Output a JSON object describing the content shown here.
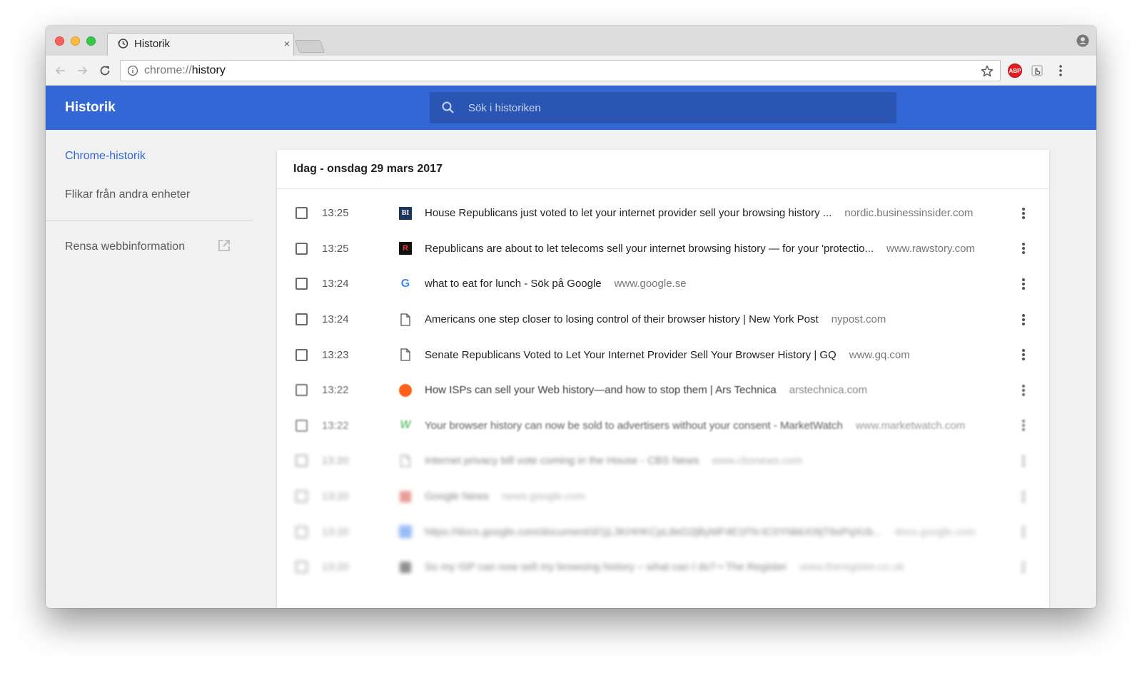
{
  "tab": {
    "title": "Historik",
    "close_label": "×"
  },
  "omnibox": {
    "scheme": "chrome://",
    "path": "history"
  },
  "extensions": {
    "abp_label": "ABP"
  },
  "header": {
    "title": "Historik",
    "search_placeholder": "Sök i historiken"
  },
  "sidebar": {
    "items": [
      {
        "label": "Chrome-historik"
      },
      {
        "label": "Flikar från andra enheter"
      },
      {
        "label": "Rensa webbinformation"
      }
    ]
  },
  "card": {
    "date_heading": "Idag - onsdag 29 mars 2017"
  },
  "rows": [
    {
      "time": "13:25",
      "favicon": "businessinsider-icon",
      "title": "House Republicans just voted to let your internet provider sell your browsing history ...",
      "domain": "nordic.businessinsider.com"
    },
    {
      "time": "13:25",
      "favicon": "rawstory-icon",
      "title": "Republicans are about to let telecoms sell your internet browsing history — for your 'protectio...",
      "domain": "www.rawstory.com"
    },
    {
      "time": "13:24",
      "favicon": "google-icon",
      "title": "what to eat for lunch - Sök på Google",
      "domain": "www.google.se"
    },
    {
      "time": "13:24",
      "favicon": "page-icon",
      "title": "Americans one step closer to losing control of their browser history | New York Post",
      "domain": "nypost.com"
    },
    {
      "time": "13:23",
      "favicon": "page-icon",
      "title": "Senate Republicans Voted to Let Your Internet Provider Sell Your Browser History | GQ",
      "domain": "www.gq.com"
    },
    {
      "time": "13:22",
      "favicon": "arstechnica-icon",
      "title": "How ISPs can sell your Web history—and how to stop them | Ars Technica",
      "domain": "arstechnica.com"
    },
    {
      "time": "13:22",
      "favicon": "marketwatch-icon",
      "title": "Your browser history can now be sold to advertisers without your consent - MarketWatch",
      "domain": "www.marketwatch.com"
    },
    {
      "time": "13:20",
      "favicon": "page-icon",
      "title": "Internet privacy bill vote coming in the House - CBS News",
      "domain": "www.cbsnews.com"
    },
    {
      "time": "13:20",
      "favicon": "google-news-icon",
      "title": "Google News",
      "domain": "news.google.com"
    },
    {
      "time": "13:20",
      "favicon": "google-docs-icon",
      "title": "https://docs.google.com/document/d/1jL3KHHKCpL8eD2jByMF4E1FN-tC0YNkkXI9jT6ePqXcb...",
      "domain": "docs.google.com"
    },
    {
      "time": "13:20",
      "favicon": "theregister-icon",
      "title": "So my ISP can now sell my browsing history – what can I do? • The Register",
      "domain": "www.theregister.co.uk"
    }
  ],
  "colors": {
    "header_bg": "#3367d6",
    "search_bg": "#2a55b3",
    "active_link": "#3367d6"
  }
}
